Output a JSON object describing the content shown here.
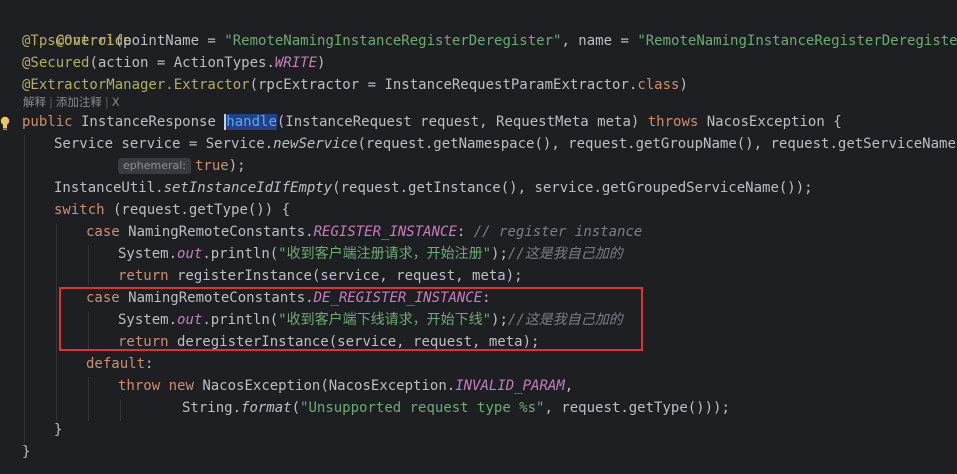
{
  "code": {
    "l1": "@Override",
    "l2_ann": "@TpsControl",
    "l2_a": "(pointName = ",
    "l2_s1": "\"RemoteNamingInstanceRegisterDeregister\"",
    "l2_b": ", name = ",
    "l2_s2": "\"RemoteNamingInstanceRegisterDeregister\"",
    "l2_c": ")",
    "l3_ann": "@Secured",
    "l3_a": "(action = ActionTypes.",
    "l3_f": "WRITE",
    "l3_b": ")",
    "l4_ann": "@ExtractorManager.Extractor",
    "l4_a": "(rpcExtractor = InstanceRequestParamExtractor.",
    "l4_kw": "class",
    "l4_b": ")",
    "hint_explain": "解释",
    "hint_add_comment": "添加注释",
    "hint_close": "X",
    "l5_kw": "public",
    "l5_a": " InstanceResponse ",
    "l5_fn": "handle",
    "l5_b": "(InstanceRequest request, RequestMeta meta) ",
    "l5_kw2": "throws",
    "l5_c": " NacosException {",
    "l6_a": "Service service = Service.",
    "l6_sfn": "newService",
    "l6_b": "(request.getNamespace(), request.getGroupName(), request.getServiceName(),",
    "l7_inlay": "ephemeral:",
    "l7_kw": "true",
    "l7_a": ");",
    "l8_a": "InstanceUtil.",
    "l8_sfn": "setInstanceIdIfEmpty",
    "l8_b": "(request.getInstance(), service.getGroupedServiceName());",
    "l9_kw": "switch",
    "l9_a": " (request.getType()) {",
    "l10_kw": "case",
    "l10_a": " NamingRemoteConstants.",
    "l10_f": "REGISTER_INSTANCE",
    "l10_b": ": ",
    "l10_cmt": "// register instance",
    "l11_a": "System.",
    "l11_f": "out",
    "l11_b": ".println(",
    "l11_s": "\"收到客户端注册请求，开始注册\"",
    "l11_c": ");",
    "l11_cmt": "//这是我自己加的",
    "l12_kw": "return",
    "l12_a": " registerInstance(service, request, meta);",
    "l13_kw": "case",
    "l13_a": " NamingRemoteConstants.",
    "l13_f": "DE_REGISTER_INSTANCE",
    "l13_b": ":",
    "l14_a": "System.",
    "l14_f": "out",
    "l14_b": ".println(",
    "l14_s": "\"收到客户端下线请求，开始下线\"",
    "l14_c": ");",
    "l14_cmt": "//这是我自己加的",
    "l15_kw": "return",
    "l15_a": " deregisterInstance(service, request, meta);",
    "l16_kw": "default",
    "l16_a": ":",
    "l17_kw": "throw",
    "l17_kw2": "new",
    "l17_a": " NacosException(NacosException.",
    "l17_f": "INVALID_PARAM",
    "l17_b": ",",
    "l18_a": "String.",
    "l18_sfn": "format",
    "l18_b": "(",
    "l18_s": "\"Unsupported request type %s\"",
    "l18_c": ", request.getType()));",
    "l19": "}",
    "l20": "}"
  },
  "colors": {
    "background": "#1e1f22",
    "annotation": "#b3ae60",
    "string": "#6aab73",
    "keyword": "#cf8e6d",
    "constant": "#c77dbb",
    "method": "#56a8f5",
    "comment": "#7a7e85",
    "highlight_box": "#e03131"
  },
  "icons": {
    "gutter": "lightbulb-icon"
  }
}
